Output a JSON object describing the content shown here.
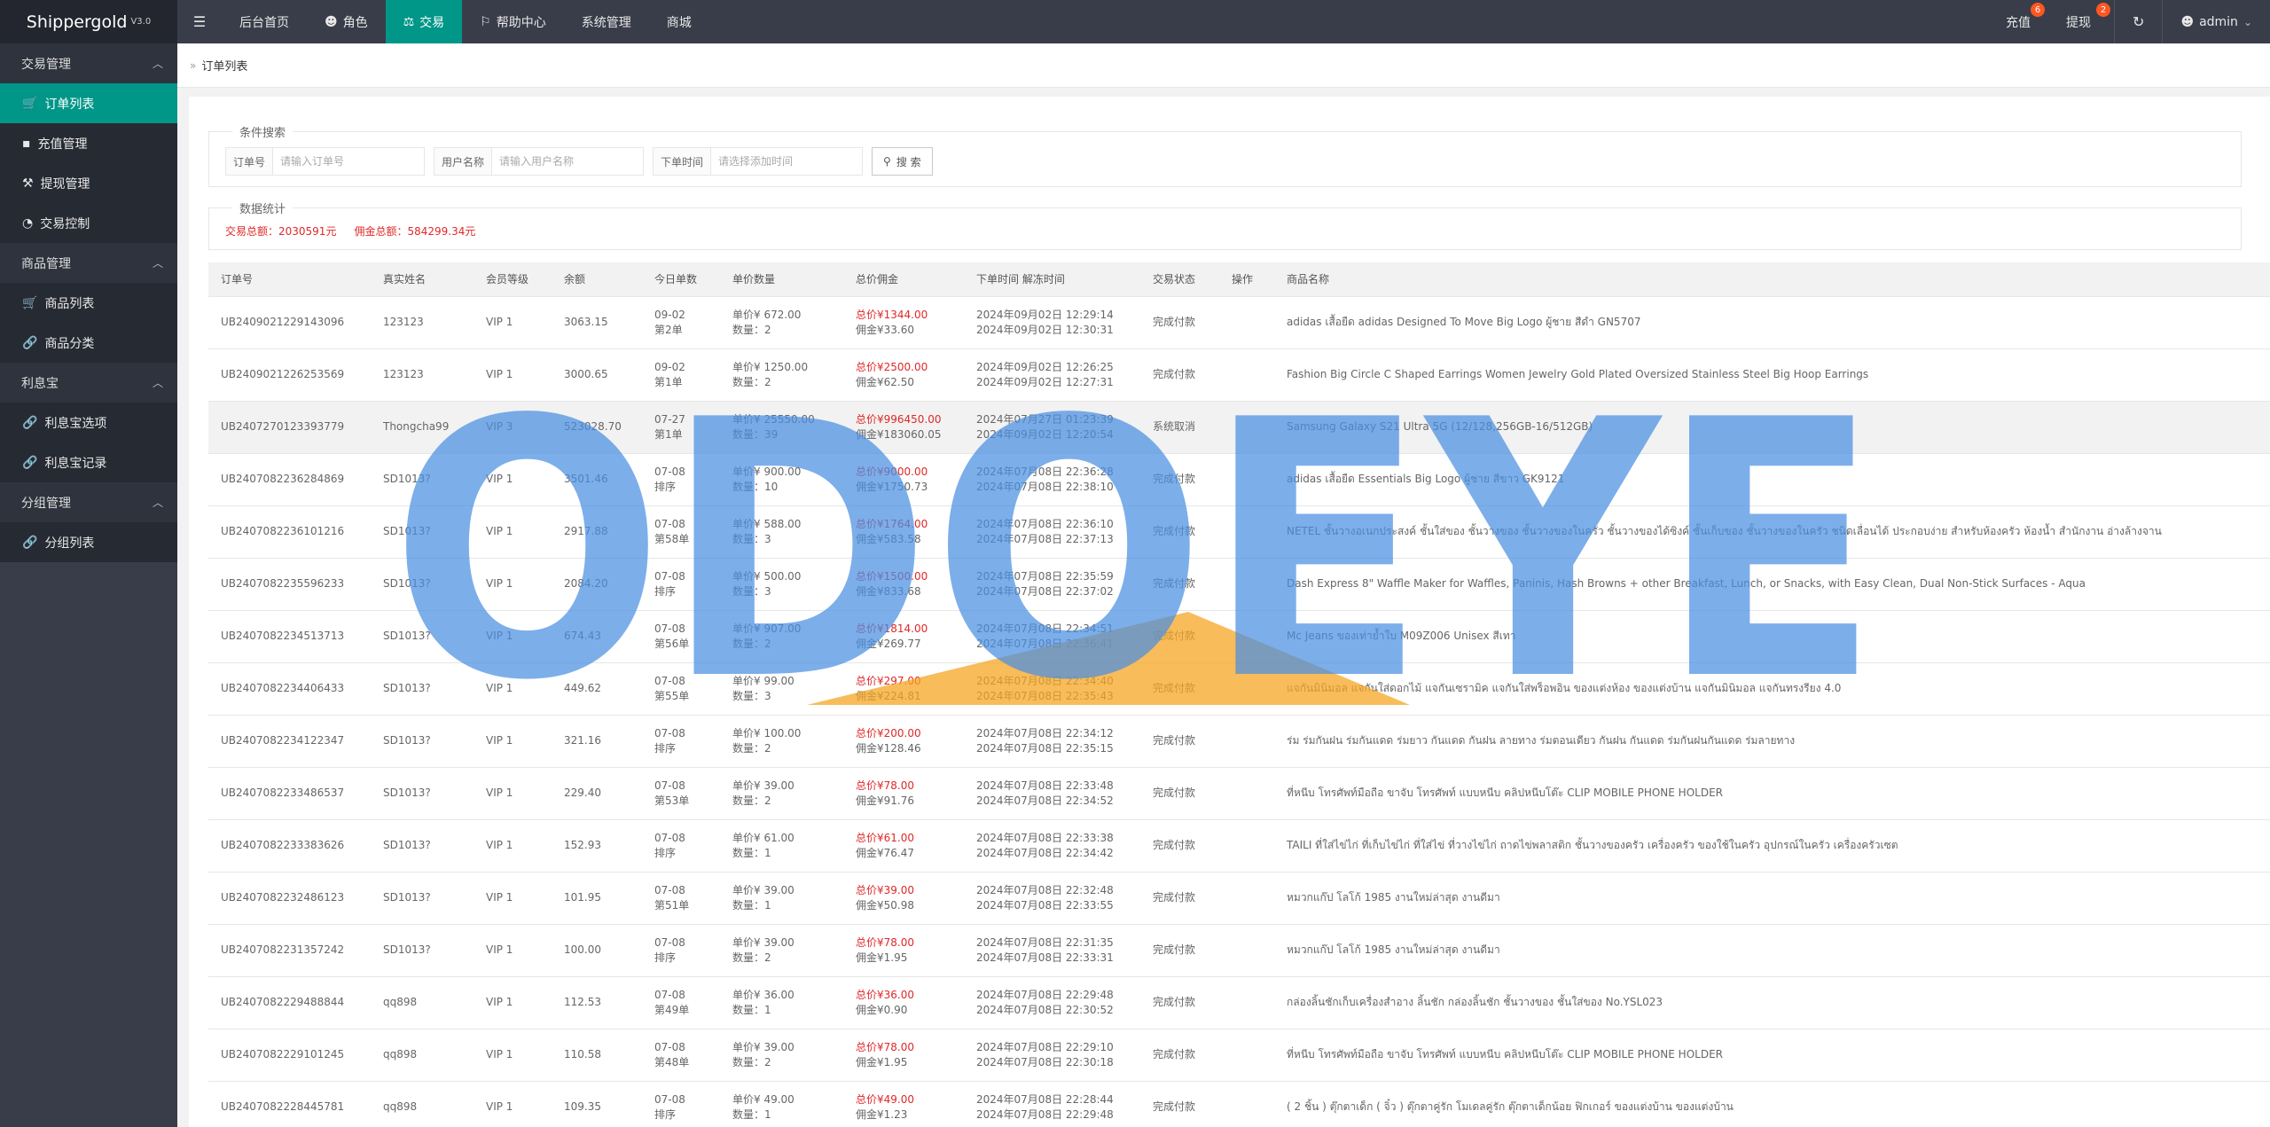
{
  "app": {
    "title": "Shippergold",
    "version": "V3.0"
  },
  "topnav": {
    "menu_icon": "menu-icon",
    "items": [
      {
        "label": "后台首页",
        "icon": ""
      },
      {
        "label": "角色",
        "icon": "user-icon"
      },
      {
        "label": "交易",
        "icon": "scale-icon"
      },
      {
        "label": "帮助中心",
        "icon": "flag-icon"
      },
      {
        "label": "系统管理",
        "icon": ""
      },
      {
        "label": "商城",
        "icon": ""
      }
    ],
    "recharge": {
      "label": "充值",
      "badge": "6"
    },
    "withdraw": {
      "label": "提现",
      "badge": "2"
    },
    "user": "admin"
  },
  "sidebar": {
    "groups": [
      {
        "label": "交易管理",
        "items": [
          {
            "label": "订单列表",
            "icon": "cart-icon"
          },
          {
            "label": "充值管理",
            "icon": "chat-icon"
          },
          {
            "label": "提现管理",
            "icon": "hammer-icon"
          },
          {
            "label": "交易控制",
            "icon": "dashboard-icon"
          }
        ]
      },
      {
        "label": "商品管理",
        "items": [
          {
            "label": "商品列表",
            "icon": "cart-icon"
          },
          {
            "label": "商品分类",
            "icon": "link-icon"
          }
        ]
      },
      {
        "label": "利息宝",
        "items": [
          {
            "label": "利息宝选项",
            "icon": "link-icon"
          },
          {
            "label": "利息宝记录",
            "icon": "link-icon"
          }
        ]
      },
      {
        "label": "分组管理",
        "items": [
          {
            "label": "分组列表",
            "icon": "link-icon"
          }
        ]
      }
    ]
  },
  "breadcrumb": "订单列表",
  "search": {
    "legend": "条件搜索",
    "order_label": "订单号",
    "order_placeholder": "请输入订单号",
    "user_label": "用户名称",
    "user_placeholder": "请输入用户名称",
    "time_label": "下单时间",
    "time_placeholder": "请选择添加时间",
    "button": "搜 索"
  },
  "stats": {
    "legend": "数据统计",
    "total": "交易总额：2030591元",
    "commission": "佣金总额：584299.34元"
  },
  "table": {
    "headers": [
      "订单号",
      "真实姓名",
      "会员等级",
      "余额",
      "今日单数",
      "单价数量",
      "总价佣金",
      "下单时间 解冻时间",
      "交易状态",
      "操作",
      "商品名称"
    ],
    "rows": [
      {
        "id": "UB2409021229143096",
        "name": "123123",
        "level": "VIP 1",
        "balance": "3063.15",
        "date": "09-02",
        "rank": "第2单",
        "price": "单价¥  672.00",
        "qty": "数量：2",
        "total": "总价¥1344.00",
        "comm": "佣金¥33.60",
        "t1": "2024年09月02日 12:29:14",
        "t2": "2024年09月02日 12:30:31",
        "status": "完成付款",
        "product": "adidas เสื้อยืด adidas Designed To Move Big Logo ผู้ชาย สีดำ GN5707"
      },
      {
        "id": "UB2409021226253569",
        "name": "123123",
        "level": "VIP 1",
        "balance": "3000.65",
        "date": "09-02",
        "rank": "第1单",
        "price": "单价¥  1250.00",
        "qty": "数量：2",
        "total": "总价¥2500.00",
        "comm": "佣金¥62.50",
        "t1": "2024年09月02日 12:26:25",
        "t2": "2024年09月02日 12:27:31",
        "status": "完成付款",
        "product": "Fashion Big Circle C Shaped Earrings Women Jewelry Gold Plated Oversized Stainless Steel Big Hoop Earrings"
      },
      {
        "id": "UB2407270123393779",
        "name": "Thongcha99",
        "level": "VIP 3",
        "balance": "523028.70",
        "date": "07-27",
        "rank": "第1单",
        "price": "单价¥  25550.00",
        "qty": "数量：39",
        "total": "总价¥996450.00",
        "comm": "佣金¥183060.05",
        "t1": "2024年07月27日 01:23:39",
        "t2": "2024年09月02日 12:20:54",
        "status": "系统取消",
        "product": "Samsung Galaxy S21 Ultra 5G (12/128,256GB-16/512GB)"
      },
      {
        "id": "UB2407082236284869",
        "name": "SD1013?",
        "level": "VIP 1",
        "balance": "3501.46",
        "date": "07-08",
        "rank": "排序",
        "price": "单价¥  900.00",
        "qty": "数量：10",
        "total": "总价¥9000.00",
        "comm": "佣金¥1750.73",
        "t1": "2024年07月08日 22:36:28",
        "t2": "2024年07月08日 22:38:10",
        "status": "完成付款",
        "product": "adidas เสื้อยืด Essentials Big Logo ผู้ชาย สีขาว GK9121"
      },
      {
        "id": "UB2407082236101216",
        "name": "SD1013?",
        "level": "VIP 1",
        "balance": "2917.88",
        "date": "07-08",
        "rank": "第58单",
        "price": "单价¥  588.00",
        "qty": "数量：3",
        "total": "总价¥1764.00",
        "comm": "佣金¥583.58",
        "t1": "2024年07月08日 22:36:10",
        "t2": "2024年07月08日 22:37:13",
        "status": "完成付款",
        "product": "NETEL ชั้นวางอเนกประสงค์ ชั้นใส่ของ ชั้นวางของ ชั้นวางของในครัว ชั้นวางของได้ซิงค์ ชั้นเก็บของ ชั้นวางของในครัว ชนิดเลื่อนได้ ประกอบง่าย สำหรับห้องครัว ห้องน้ำ สำนักงาน อ่างล้างจาน"
      },
      {
        "id": "UB2407082235596233",
        "name": "SD1013?",
        "level": "VIP 1",
        "balance": "2084.20",
        "date": "07-08",
        "rank": "排序",
        "price": "单价¥  500.00",
        "qty": "数量：3",
        "total": "总价¥1500.00",
        "comm": "佣金¥833.68",
        "t1": "2024年07月08日 22:35:59",
        "t2": "2024年07月08日 22:37:02",
        "status": "完成付款",
        "product": "Dash Express 8\"  Waffle Maker for Waffles, Paninis, Hash Browns + other Breakfast, Lunch, or Snacks, with Easy Clean, Dual Non-Stick Surfaces - Aqua"
      },
      {
        "id": "UB2407082234513713",
        "name": "SD1013?",
        "level": "VIP 1",
        "balance": "674.43",
        "date": "07-08",
        "rank": "第56单",
        "price": "单价¥  907.00",
        "qty": "数量：2",
        "total": "总价¥1814.00",
        "comm": "佣金¥269.77",
        "t1": "2024年07月08日 22:34:51",
        "t2": "2024年07月08日 22:36:41",
        "status": "完成付款",
        "product": "Mc Jeans ของเท่าย้ำใบ M09Z006 Unisex สีเทา"
      },
      {
        "id": "UB2407082234406433",
        "name": "SD1013?",
        "level": "VIP 1",
        "balance": "449.62",
        "date": "07-08",
        "rank": "第55单",
        "price": "单价¥  99.00",
        "qty": "数量：3",
        "total": "总价¥297.00",
        "comm": "佣金¥224.81",
        "t1": "2024年07月08日 22:34:40",
        "t2": "2024年07月08日 22:35:43",
        "status": "完成付款",
        "product": "แจกันมินิมอล แจกันใส่ดอกไม้ แจกันเซรามิค แจกันใส่พร็อพอิน ของแต่งห้อง ของแต่งบ้าน แจกันมินิมอล แจกันทรงรียง 4.0"
      },
      {
        "id": "UB2407082234122347",
        "name": "SD1013?",
        "level": "VIP 1",
        "balance": "321.16",
        "date": "07-08",
        "rank": "排序",
        "price": "单价¥  100.00",
        "qty": "数量：2",
        "total": "总价¥200.00",
        "comm": "佣金¥128.46",
        "t1": "2024年07月08日 22:34:12",
        "t2": "2024年07月08日 22:35:15",
        "status": "完成付款",
        "product": "ร่ม ร่มกันฝน ร่มกันแดด ร่มยาว กันแดด กันฝน ลายทาง ร่มตอนเดียว กันฝน กันแดด ร่มกันฝนกันแดด ร่มลายทาง"
      },
      {
        "id": "UB2407082233486537",
        "name": "SD1013?",
        "level": "VIP 1",
        "balance": "229.40",
        "date": "07-08",
        "rank": "第53单",
        "price": "单价¥  39.00",
        "qty": "数量：2",
        "total": "总价¥78.00",
        "comm": "佣金¥91.76",
        "t1": "2024年07月08日 22:33:48",
        "t2": "2024年07月08日 22:34:52",
        "status": "完成付款",
        "product": "ที่หนีบ โทรศัพท์มือถือ ขาจับ โทรศัพท์ แบบหนีบ คลิปหนีบโต๊ะ CLIP MOBILE PHONE HOLDER"
      },
      {
        "id": "UB2407082233383626",
        "name": "SD1013?",
        "level": "VIP 1",
        "balance": "152.93",
        "date": "07-08",
        "rank": "排序",
        "price": "单价¥  61.00",
        "qty": "数量：1",
        "total": "总价¥61.00",
        "comm": "佣金¥76.47",
        "t1": "2024年07月08日 22:33:38",
        "t2": "2024年07月08日 22:34:42",
        "status": "完成付款",
        "product": "TAILI ที่ใส่ไข่ไก่ ที่เก็บไข่ไก่ ที่ใส่ไข่ ที่วางไข่ไก่ ถาดไข่พลาสติก ชั้นวางของครัว เครื่องครัว ของใช้ในครัว อุปกรณ์ในครัว เครื่องครัวเซต"
      },
      {
        "id": "UB2407082232486123",
        "name": "SD1013?",
        "level": "VIP 1",
        "balance": "101.95",
        "date": "07-08",
        "rank": "第51单",
        "price": "单价¥  39.00",
        "qty": "数量：1",
        "total": "总价¥39.00",
        "comm": "佣金¥50.98",
        "t1": "2024年07月08日 22:32:48",
        "t2": "2024年07月08日 22:33:55",
        "status": "完成付款",
        "product": "หมวกแก๊ป โลโก้ 1985 งานใหม่ล่าสุด งานดีมา"
      },
      {
        "id": "UB2407082231357242",
        "name": "SD1013?",
        "level": "VIP 1",
        "balance": "100.00",
        "date": "07-08",
        "rank": "排序",
        "price": "单价¥  39.00",
        "qty": "数量：2",
        "total": "总价¥78.00",
        "comm": "佣金¥1.95",
        "t1": "2024年07月08日 22:31:35",
        "t2": "2024年07月08日 22:33:31",
        "status": "完成付款",
        "product": "หมวกแก๊ป โลโก้ 1985 งานใหม่ล่าสุด งานดีมา"
      },
      {
        "id": "UB2407082229488844",
        "name": "qq898",
        "level": "VIP 1",
        "balance": "112.53",
        "date": "07-08",
        "rank": "第49单",
        "price": "单价¥  36.00",
        "qty": "数量：1",
        "total": "总价¥36.00",
        "comm": "佣金¥0.90",
        "t1": "2024年07月08日 22:29:48",
        "t2": "2024年07月08日 22:30:52",
        "status": "完成付款",
        "product": "กล่องลิ้นชักเก็บเครื่องสำอาง ลิ้นชัก กล่องลิ้นชัก ชั้นวางของ ชั้นใส่ของ No.YSL023"
      },
      {
        "id": "UB2407082229101245",
        "name": "qq898",
        "level": "VIP 1",
        "balance": "110.58",
        "date": "07-08",
        "rank": "第48单",
        "price": "单价¥  39.00",
        "qty": "数量：2",
        "total": "总价¥78.00",
        "comm": "佣金¥1.95",
        "t1": "2024年07月08日 22:29:10",
        "t2": "2024年07月08日 22:30:18",
        "status": "完成付款",
        "product": "ที่หนีบ โทรศัพท์มือถือ ขาจับ โทรศัพท์ แบบหนีบ คลิปหนีบโต๊ะ CLIP MOBILE PHONE HOLDER"
      },
      {
        "id": "UB2407082228445781",
        "name": "qq898",
        "level": "VIP 1",
        "balance": "109.35",
        "date": "07-08",
        "rank": "排序",
        "price": "单价¥  49.00",
        "qty": "数量：1",
        "total": "总价¥49.00",
        "comm": "佣金¥1.23",
        "t1": "2024年07月08日 22:28:44",
        "t2": "2024年07月08日 22:29:48",
        "status": "完成付款",
        "product": "( 2 ชิ้น ) ตุ๊กตาเด็ก ( จิ๋ว ) ตุ๊กตาคู่รัก โมเดลคู่รัก ตุ๊กตาเด็กน้อย ฟิกเกอร์ ของแต่งบ้าน ของแต่งบ้าน"
      }
    ]
  },
  "watermark": {
    "text": "ODOEYE",
    "color": "#4a8fe2",
    "accent": "#f5a623"
  },
  "colors": {
    "accent": "#009688",
    "topbar": "#393d49",
    "price_red": "#e02828",
    "badge": "#ff5722"
  }
}
